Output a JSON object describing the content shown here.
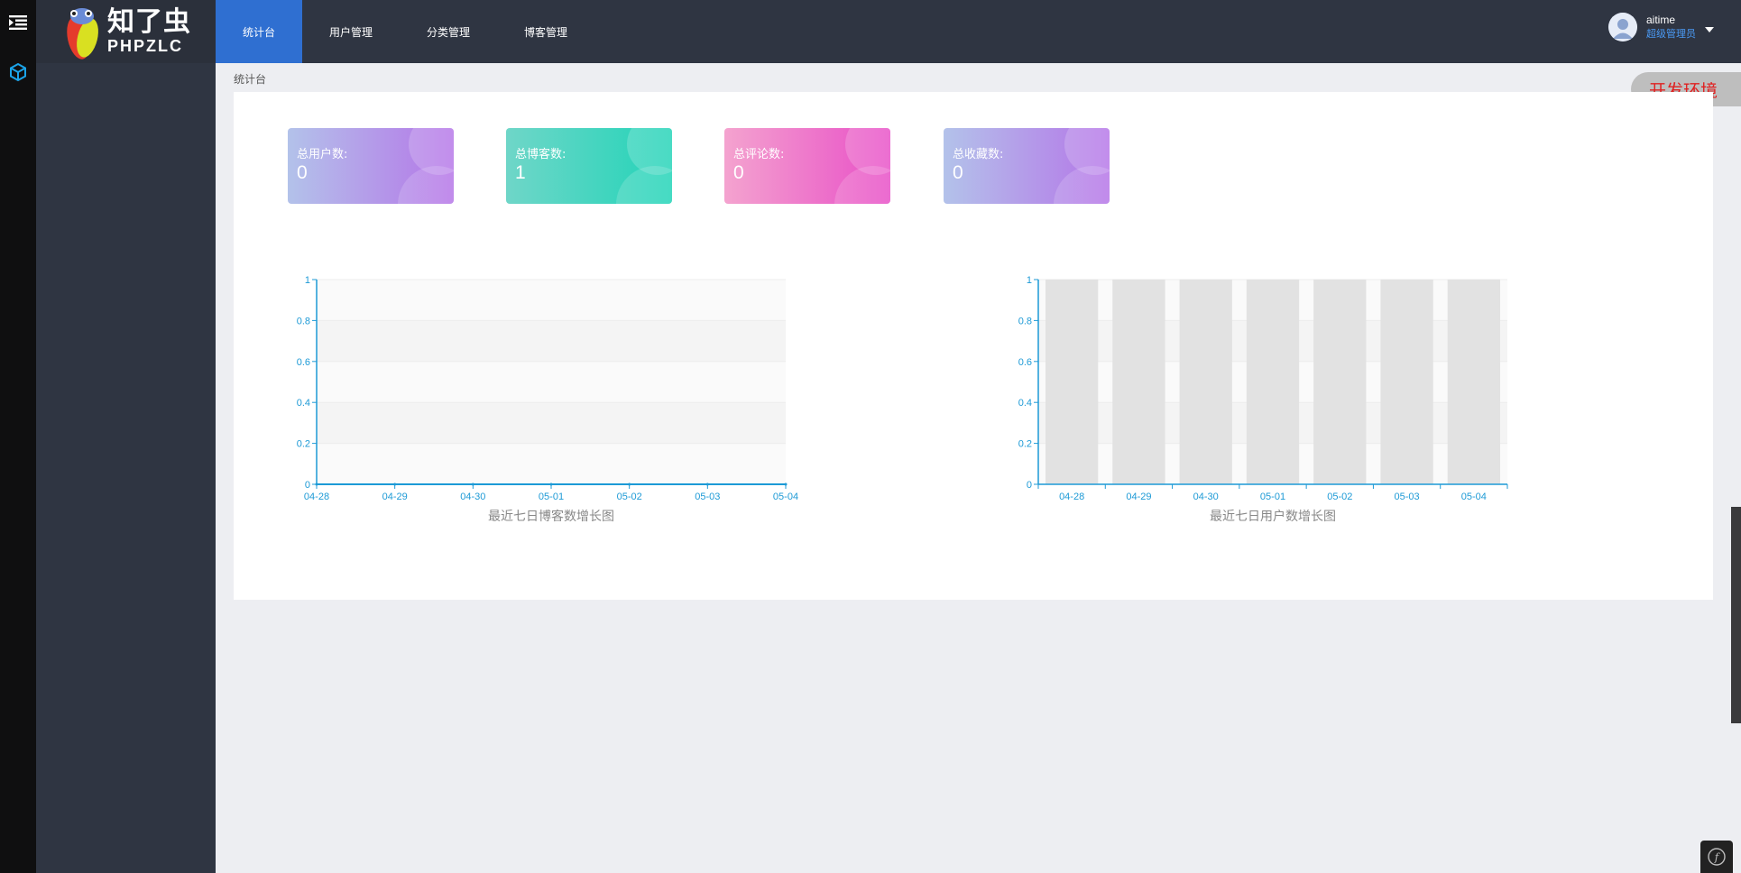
{
  "app": {
    "logo_cn": "知了虫",
    "logo_en": "PHPZLC"
  },
  "nav": {
    "items": [
      {
        "label": "统计台",
        "active": true
      },
      {
        "label": "用户管理",
        "active": false
      },
      {
        "label": "分类管理",
        "active": false
      },
      {
        "label": "博客管理",
        "active": false
      }
    ]
  },
  "user": {
    "name": "aitime",
    "role": "超级管理员"
  },
  "breadcrumb": "统计台",
  "env_badge": "开发环境",
  "stats": [
    {
      "label": "总用户数:",
      "value": "0",
      "gradient": [
        "#b3c2ea",
        "#b575e8"
      ]
    },
    {
      "label": "总博客数:",
      "value": "1",
      "gradient": [
        "#6fd6c8",
        "#22d4b8"
      ]
    },
    {
      "label": "总评论数:",
      "value": "0",
      "gradient": [
        "#f4a3cf",
        "#e84fc7"
      ]
    },
    {
      "label": "总收藏数:",
      "value": "0",
      "gradient": [
        "#b3c2ea",
        "#b575e8"
      ]
    }
  ],
  "chart_data": [
    {
      "type": "line",
      "title": "最近七日博客数增长图",
      "categories": [
        "04-28",
        "04-29",
        "04-30",
        "05-01",
        "05-02",
        "05-03",
        "05-04"
      ],
      "values": [
        0,
        0,
        0,
        0,
        0,
        0,
        0
      ],
      "yticks": [
        "0",
        "0.2",
        "0.4",
        "0.6",
        "0.8",
        "1"
      ],
      "ylim": [
        0,
        1
      ],
      "color": "#1d9ad6"
    },
    {
      "type": "bar",
      "title": "最近七日用户数增长图",
      "categories": [
        "04-28",
        "04-29",
        "04-30",
        "05-01",
        "05-02",
        "05-03",
        "05-04"
      ],
      "values": [
        0,
        0,
        0,
        0,
        0,
        0,
        0
      ],
      "yticks": [
        "0",
        "0.2",
        "0.4",
        "0.6",
        "0.8",
        "1"
      ],
      "ylim": [
        0,
        1
      ],
      "color": "#1d9ad6"
    }
  ]
}
